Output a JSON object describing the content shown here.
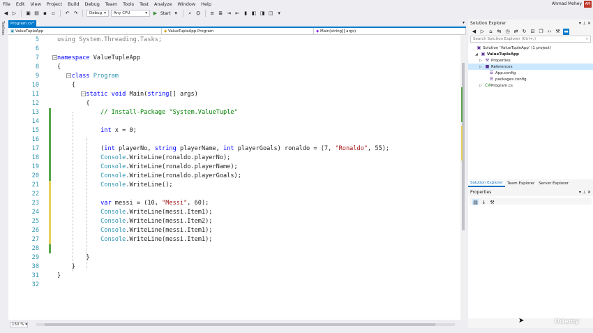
{
  "menu": [
    "File",
    "Edit",
    "View",
    "Project",
    "Build",
    "Debug",
    "Team",
    "Tools",
    "Test",
    "Analyze",
    "Window",
    "Help"
  ],
  "user": {
    "name": "Ahmad Mohey",
    "initials": "AM"
  },
  "toolbar": {
    "config": "Debug",
    "platform": "Any CPU",
    "start_label": "Start"
  },
  "toolbox_label": "Toolbox",
  "doc_tab": {
    "title": "Program.cs*"
  },
  "navbar": {
    "project": "ValueTupleApp",
    "class": "ValueTupleApp.Program",
    "member": "Main(string[] args)"
  },
  "code_lines": [
    {
      "n": "5",
      "mark": "",
      "tokens": [
        {
          "t": "using System.Threading.Tasks;",
          "c": "gr"
        }
      ]
    },
    {
      "n": "6",
      "mark": "",
      "tokens": []
    },
    {
      "n": "7",
      "mark": "",
      "tokens": [
        {
          "t": "namespace",
          "c": "kw"
        },
        {
          "t": " ValueTupleApp",
          "c": ""
        }
      ]
    },
    {
      "n": "8",
      "mark": "",
      "tokens": [
        {
          "t": "{",
          "c": ""
        }
      ]
    },
    {
      "n": "9",
      "mark": "",
      "tokens": [
        {
          "t": "    ",
          "c": ""
        },
        {
          "t": "class",
          "c": "kw"
        },
        {
          "t": " ",
          "c": ""
        },
        {
          "t": "Program",
          "c": "ty"
        }
      ]
    },
    {
      "n": "10",
      "mark": "",
      "tokens": [
        {
          "t": "    {",
          "c": ""
        }
      ]
    },
    {
      "n": "11",
      "mark": "",
      "tokens": [
        {
          "t": "        ",
          "c": ""
        },
        {
          "t": "static",
          "c": "kw"
        },
        {
          "t": " ",
          "c": ""
        },
        {
          "t": "void",
          "c": "kw"
        },
        {
          "t": " Main(",
          "c": ""
        },
        {
          "t": "string",
          "c": "kw"
        },
        {
          "t": "[] args)",
          "c": ""
        }
      ]
    },
    {
      "n": "12",
      "mark": "",
      "tokens": [
        {
          "t": "        {",
          "c": ""
        }
      ]
    },
    {
      "n": "13",
      "mark": "green",
      "tokens": [
        {
          "t": "            ",
          "c": ""
        },
        {
          "t": "// Install-Package \"System.ValueTuple\"",
          "c": "cm"
        }
      ]
    },
    {
      "n": "14",
      "mark": "green",
      "tokens": []
    },
    {
      "n": "15",
      "mark": "green",
      "tokens": [
        {
          "t": "            ",
          "c": ""
        },
        {
          "t": "int",
          "c": "kw"
        },
        {
          "t": " x = 0;",
          "c": ""
        }
      ]
    },
    {
      "n": "16",
      "mark": "green",
      "tokens": []
    },
    {
      "n": "17",
      "mark": "green",
      "tokens": [
        {
          "t": "            (",
          "c": ""
        },
        {
          "t": "int",
          "c": "kw"
        },
        {
          "t": " playerNo, ",
          "c": ""
        },
        {
          "t": "string",
          "c": "kw"
        },
        {
          "t": " playerName, ",
          "c": ""
        },
        {
          "t": "int",
          "c": "kw"
        },
        {
          "t": " playerGoals) ronaldo = (7, ",
          "c": ""
        },
        {
          "t": "\"Ronaldo\"",
          "c": "st"
        },
        {
          "t": ", 55);",
          "c": ""
        }
      ]
    },
    {
      "n": "18",
      "mark": "green",
      "tokens": [
        {
          "t": "            ",
          "c": ""
        },
        {
          "t": "Console",
          "c": "ty"
        },
        {
          "t": ".WriteLine(ronaldo.playerNo);",
          "c": ""
        }
      ]
    },
    {
      "n": "19",
      "mark": "green",
      "tokens": [
        {
          "t": "            ",
          "c": ""
        },
        {
          "t": "Console",
          "c": "ty"
        },
        {
          "t": ".WriteLine(ronaldo.playerName);",
          "c": ""
        }
      ]
    },
    {
      "n": "20",
      "mark": "green",
      "tokens": [
        {
          "t": "            ",
          "c": ""
        },
        {
          "t": "Console",
          "c": "ty"
        },
        {
          "t": ".WriteLine(ronaldo.playerGoals);",
          "c": ""
        }
      ]
    },
    {
      "n": "21",
      "mark": "yellow",
      "tokens": [
        {
          "t": "            ",
          "c": ""
        },
        {
          "t": "Console",
          "c": "ty"
        },
        {
          "t": ".WriteLine();",
          "c": ""
        }
      ]
    },
    {
      "n": "22",
      "mark": "yellow",
      "tokens": []
    },
    {
      "n": "23",
      "mark": "yellow",
      "tokens": [
        {
          "t": "            ",
          "c": ""
        },
        {
          "t": "var",
          "c": "kw"
        },
        {
          "t": " messi = (10, ",
          "c": ""
        },
        {
          "t": "\"Messi\"",
          "c": "st"
        },
        {
          "t": ", 60);",
          "c": ""
        }
      ]
    },
    {
      "n": "24",
      "mark": "yellow",
      "tokens": [
        {
          "t": "            ",
          "c": ""
        },
        {
          "t": "Console",
          "c": "ty"
        },
        {
          "t": ".WriteLine(messi.Item1);",
          "c": ""
        }
      ]
    },
    {
      "n": "25",
      "mark": "yellow",
      "tokens": [
        {
          "t": "            ",
          "c": ""
        },
        {
          "t": "Console",
          "c": "ty"
        },
        {
          "t": ".WriteLine(messi.Item2);",
          "c": ""
        }
      ]
    },
    {
      "n": "26",
      "mark": "yellow",
      "tokens": [
        {
          "t": "            ",
          "c": ""
        },
        {
          "t": "Console",
          "c": "ty"
        },
        {
          "t": ".WriteLine(messi.Item1);",
          "c": ""
        }
      ]
    },
    {
      "n": "27",
      "mark": "yellow",
      "tokens": [
        {
          "t": "            ",
          "c": ""
        },
        {
          "t": "Console",
          "c": "ty"
        },
        {
          "t": ".WriteLine(messi.Item1);",
          "c": ""
        }
      ]
    },
    {
      "n": "28",
      "mark": "green",
      "tokens": []
    },
    {
      "n": "29",
      "mark": "",
      "tokens": [
        {
          "t": "        }",
          "c": ""
        }
      ]
    },
    {
      "n": "30",
      "mark": "",
      "tokens": [
        {
          "t": "    }",
          "c": ""
        }
      ]
    },
    {
      "n": "31",
      "mark": "",
      "tokens": [
        {
          "t": "}",
          "c": ""
        }
      ]
    },
    {
      "n": "32",
      "mark": "",
      "tokens": []
    }
  ],
  "zoom": "150 %",
  "solution_explorer": {
    "title": "Solution Explorer",
    "search_placeholder": "Search Solution Explorer (Ctrl+;)",
    "nodes": [
      {
        "label": "Solution 'ValueTupleApp' (1 project)",
        "icon": "▣",
        "arrow": ""
      },
      {
        "label": "ValueTupleApp",
        "icon": "▣",
        "arrow": "◢"
      },
      {
        "label": "Properties",
        "icon": "⚒",
        "arrow": "▷"
      },
      {
        "label": "References",
        "icon": "■",
        "arrow": "▷"
      },
      {
        "label": "App.config",
        "icon": "☰",
        "arrow": ""
      },
      {
        "label": "packages.config",
        "icon": "☰",
        "arrow": ""
      },
      {
        "label": "Program.cs",
        "icon": "C#",
        "arrow": "▷"
      }
    ],
    "tabs": [
      "Solution Explorer",
      "Team Explorer",
      "Server Explorer"
    ]
  },
  "properties": {
    "title": "Properties"
  },
  "watermark": "Udemy"
}
